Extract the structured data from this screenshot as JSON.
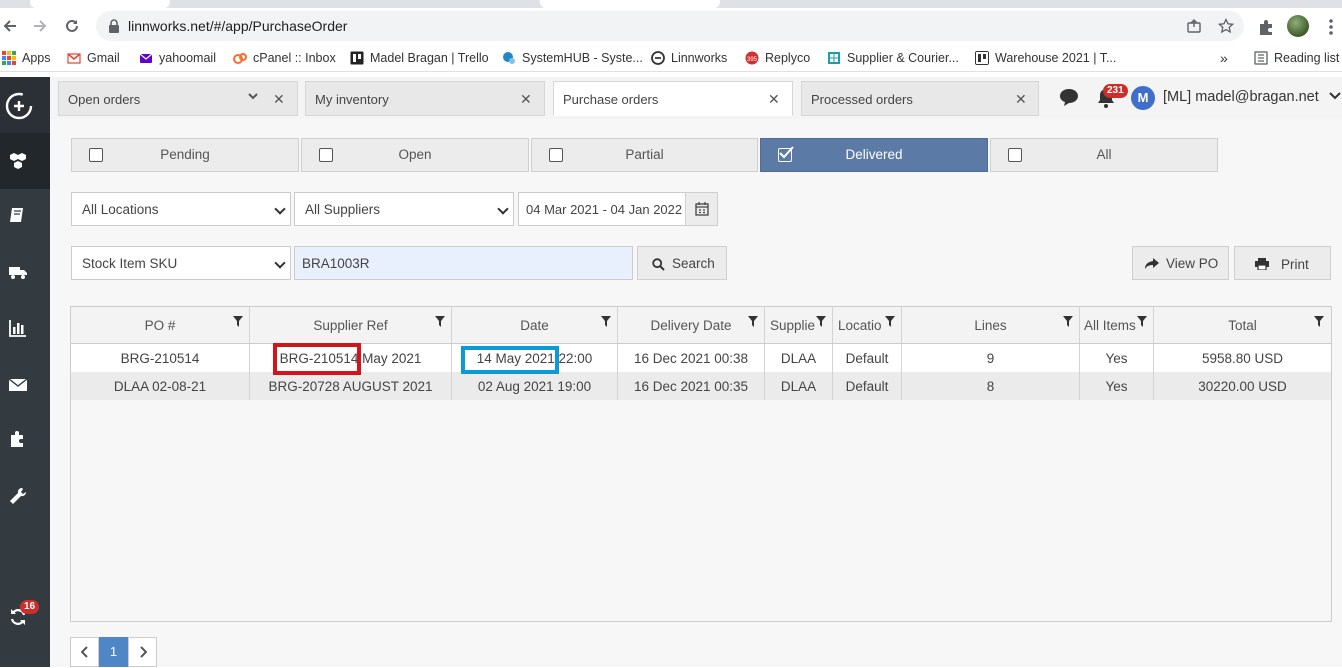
{
  "browser": {
    "url": "linnworks.net/#/app/PurchaseOrder",
    "bookmarks": [
      {
        "label": "Apps",
        "icon": "apps-grid-icon",
        "color": "#ea4335"
      },
      {
        "label": "Gmail",
        "icon": "gmail-icon",
        "color": "#ea4335"
      },
      {
        "label": "yahoomail",
        "icon": "yahoo-icon",
        "color": "#6001d2"
      },
      {
        "label": "cPanel :: Inbox",
        "icon": "cpanel-icon",
        "color": "#ff6c2c"
      },
      {
        "label": "Madel Bragan | Trello",
        "icon": "trello-icon",
        "color": "#222222"
      },
      {
        "label": "SystemHUB - Syste...",
        "icon": "systemhub-icon",
        "color": "#1e88c8"
      },
      {
        "label": "Linnworks",
        "icon": "linnworks-icon",
        "color": "#333333"
      },
      {
        "label": "Replyco",
        "icon": "replyco-icon",
        "color": "#d32f2f"
      },
      {
        "label": "Supplier & Courier...",
        "icon": "sheets-icon",
        "color": "#1aa0a8"
      },
      {
        "label": "Warehouse 2021 | T...",
        "icon": "trello-icon",
        "color": "#333333"
      }
    ],
    "reading_list": "Reading list"
  },
  "sidebar": {
    "sync_badge": "16"
  },
  "app_tabs": [
    {
      "label": "Open orders",
      "has_dropdown": true
    },
    {
      "label": "My inventory",
      "has_dropdown": false
    },
    {
      "label": "Purchase orders",
      "has_dropdown": false,
      "active": true
    },
    {
      "label": "Processed orders",
      "has_dropdown": false
    }
  ],
  "header": {
    "notification_count": "231",
    "user_initial": "M",
    "user_name": "[ML] madel@bragan.net"
  },
  "status_tabs": [
    {
      "label": "Pending",
      "checked": false
    },
    {
      "label": "Open",
      "checked": false
    },
    {
      "label": "Partial",
      "checked": false
    },
    {
      "label": "Delivered",
      "checked": true
    },
    {
      "label": "All",
      "checked": false
    }
  ],
  "filters": {
    "location": "All Locations",
    "supplier": "All Suppliers",
    "date_range": "04 Mar 2021 - 04 Jan 2022",
    "search_type": "Stock Item SKU",
    "search_value": "BRA1003R",
    "search_button": "Search",
    "view_po_button": "View PO",
    "print_button": "Print"
  },
  "grid": {
    "columns": [
      "PO #",
      "Supplier Ref",
      "Date",
      "Delivery Date",
      "Supplie",
      "Locatio",
      "Lines",
      "All Items",
      "Total"
    ],
    "rows": [
      [
        "BRG-210514",
        "BRG-210514 May 2021",
        "14 May 2021 22:00",
        "16 Dec 2021 00:38",
        "DLAA",
        "Default",
        "9",
        "Yes",
        "5958.80 USD"
      ],
      [
        "DLAA 02-08-21",
        "BRG-20728 AUGUST 2021",
        "02 Aug 2021 19:00",
        "16 Dec 2021 00:35",
        "DLAA",
        "Default",
        "8",
        "Yes",
        "30220.00 USD"
      ]
    ]
  },
  "pager": {
    "current": "1"
  }
}
